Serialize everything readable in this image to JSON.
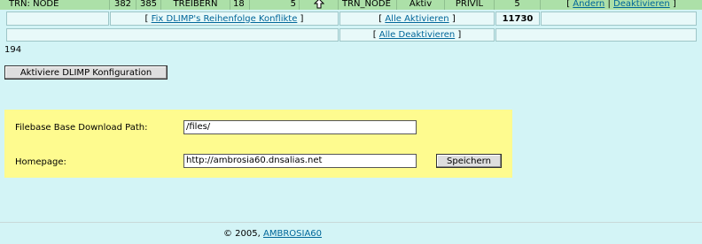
{
  "row1": {
    "col_name": "TRN: NODE",
    "n1": "382",
    "n2": "385",
    "type": "TREIBERN",
    "n3": "18",
    "n4": "5",
    "name2": "TRN_NODE",
    "status": "Aktiv",
    "priv": "PRIVIL",
    "n5": "5",
    "actions": {
      "edit": "Ändern",
      "sep": "|",
      "deactivate": "Deaktivieren"
    }
  },
  "row2": {
    "fix_link": "Fix DLIMP's Reihenfolge Konflikte",
    "activate_all": "Alle Aktivieren",
    "count": "11730"
  },
  "row3": {
    "deactivate_all": "Alle Deaktivieren"
  },
  "bracket_open": "[",
  "bracket_close": "]",
  "counter": "194",
  "activate_button": "Aktiviere DLIMP Konfiguration",
  "form": {
    "download_path_label": "Filebase Base Download Path:",
    "download_path_value": "/files/",
    "homepage_label": "Homepage:",
    "homepage_value": "http://ambrosia60.dnsalias.net",
    "save_button": "Speichern"
  },
  "footer": {
    "copyright": "© 2005,",
    "link": "AMBROSIA60"
  }
}
